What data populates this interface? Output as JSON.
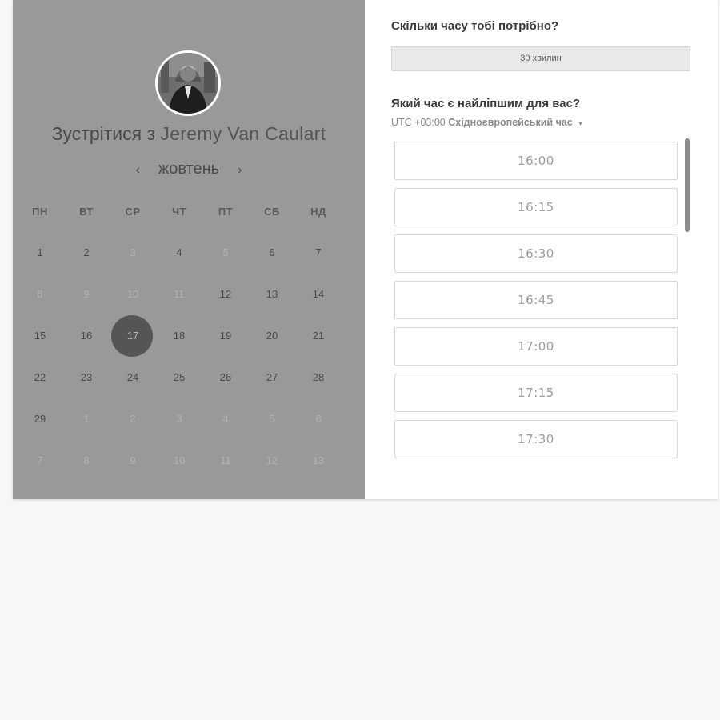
{
  "left": {
    "title_prefix": "Зустрітися з",
    "host_name": "Jeremy Van Caulart",
    "nav": {
      "prev": "‹",
      "month": "жовтень",
      "next": "›"
    },
    "weekdays": [
      "ПН",
      "ВТ",
      "СР",
      "ЧТ",
      "ПТ",
      "СБ",
      "НД"
    ],
    "weeks": [
      [
        {
          "d": "1",
          "off": false
        },
        {
          "d": "2",
          "off": false
        },
        {
          "d": "3",
          "off": true
        },
        {
          "d": "4",
          "off": false
        },
        {
          "d": "5",
          "off": true
        },
        {
          "d": "6",
          "off": false
        },
        {
          "d": "7",
          "off": false
        }
      ],
      [
        {
          "d": "8",
          "off": true
        },
        {
          "d": "9",
          "off": true
        },
        {
          "d": "10",
          "off": true
        },
        {
          "d": "11",
          "off": true
        },
        {
          "d": "12",
          "off": false
        },
        {
          "d": "13",
          "off": false
        },
        {
          "d": "14",
          "off": false
        }
      ],
      [
        {
          "d": "15",
          "off": false
        },
        {
          "d": "16",
          "off": false
        },
        {
          "d": "17",
          "off": false,
          "selected": true
        },
        {
          "d": "18",
          "off": false
        },
        {
          "d": "19",
          "off": false
        },
        {
          "d": "20",
          "off": false
        },
        {
          "d": "21",
          "off": false
        }
      ],
      [
        {
          "d": "22",
          "off": false
        },
        {
          "d": "23",
          "off": false
        },
        {
          "d": "24",
          "off": false
        },
        {
          "d": "25",
          "off": false
        },
        {
          "d": "26",
          "off": false
        },
        {
          "d": "27",
          "off": false
        },
        {
          "d": "28",
          "off": false
        }
      ],
      [
        {
          "d": "29",
          "off": false
        },
        {
          "d": "1",
          "off": true
        },
        {
          "d": "2",
          "off": true
        },
        {
          "d": "3",
          "off": true
        },
        {
          "d": "4",
          "off": true
        },
        {
          "d": "5",
          "off": true
        },
        {
          "d": "6",
          "off": true
        }
      ],
      [
        {
          "d": "7",
          "off": true
        },
        {
          "d": "8",
          "off": true
        },
        {
          "d": "9",
          "off": true
        },
        {
          "d": "10",
          "off": true
        },
        {
          "d": "11",
          "off": true
        },
        {
          "d": "12",
          "off": true
        },
        {
          "d": "13",
          "off": true
        }
      ]
    ]
  },
  "right": {
    "duration_question": "Скільки часу тобі потрібно?",
    "duration_value": "30 хвилин",
    "time_question": "Який час є найліпшим для вас?",
    "timezone_offset": "UTC +03:00",
    "timezone_name": "Східноєвропейський час",
    "timezone_caret": "▾",
    "slots": [
      "16:00",
      "16:15",
      "16:30",
      "16:45",
      "17:00",
      "17:15",
      "17:30",
      ""
    ]
  },
  "colors": {
    "left_panel_bg": "#999999",
    "selected_day": "#555555",
    "page_bg": "#f7f7f7"
  }
}
